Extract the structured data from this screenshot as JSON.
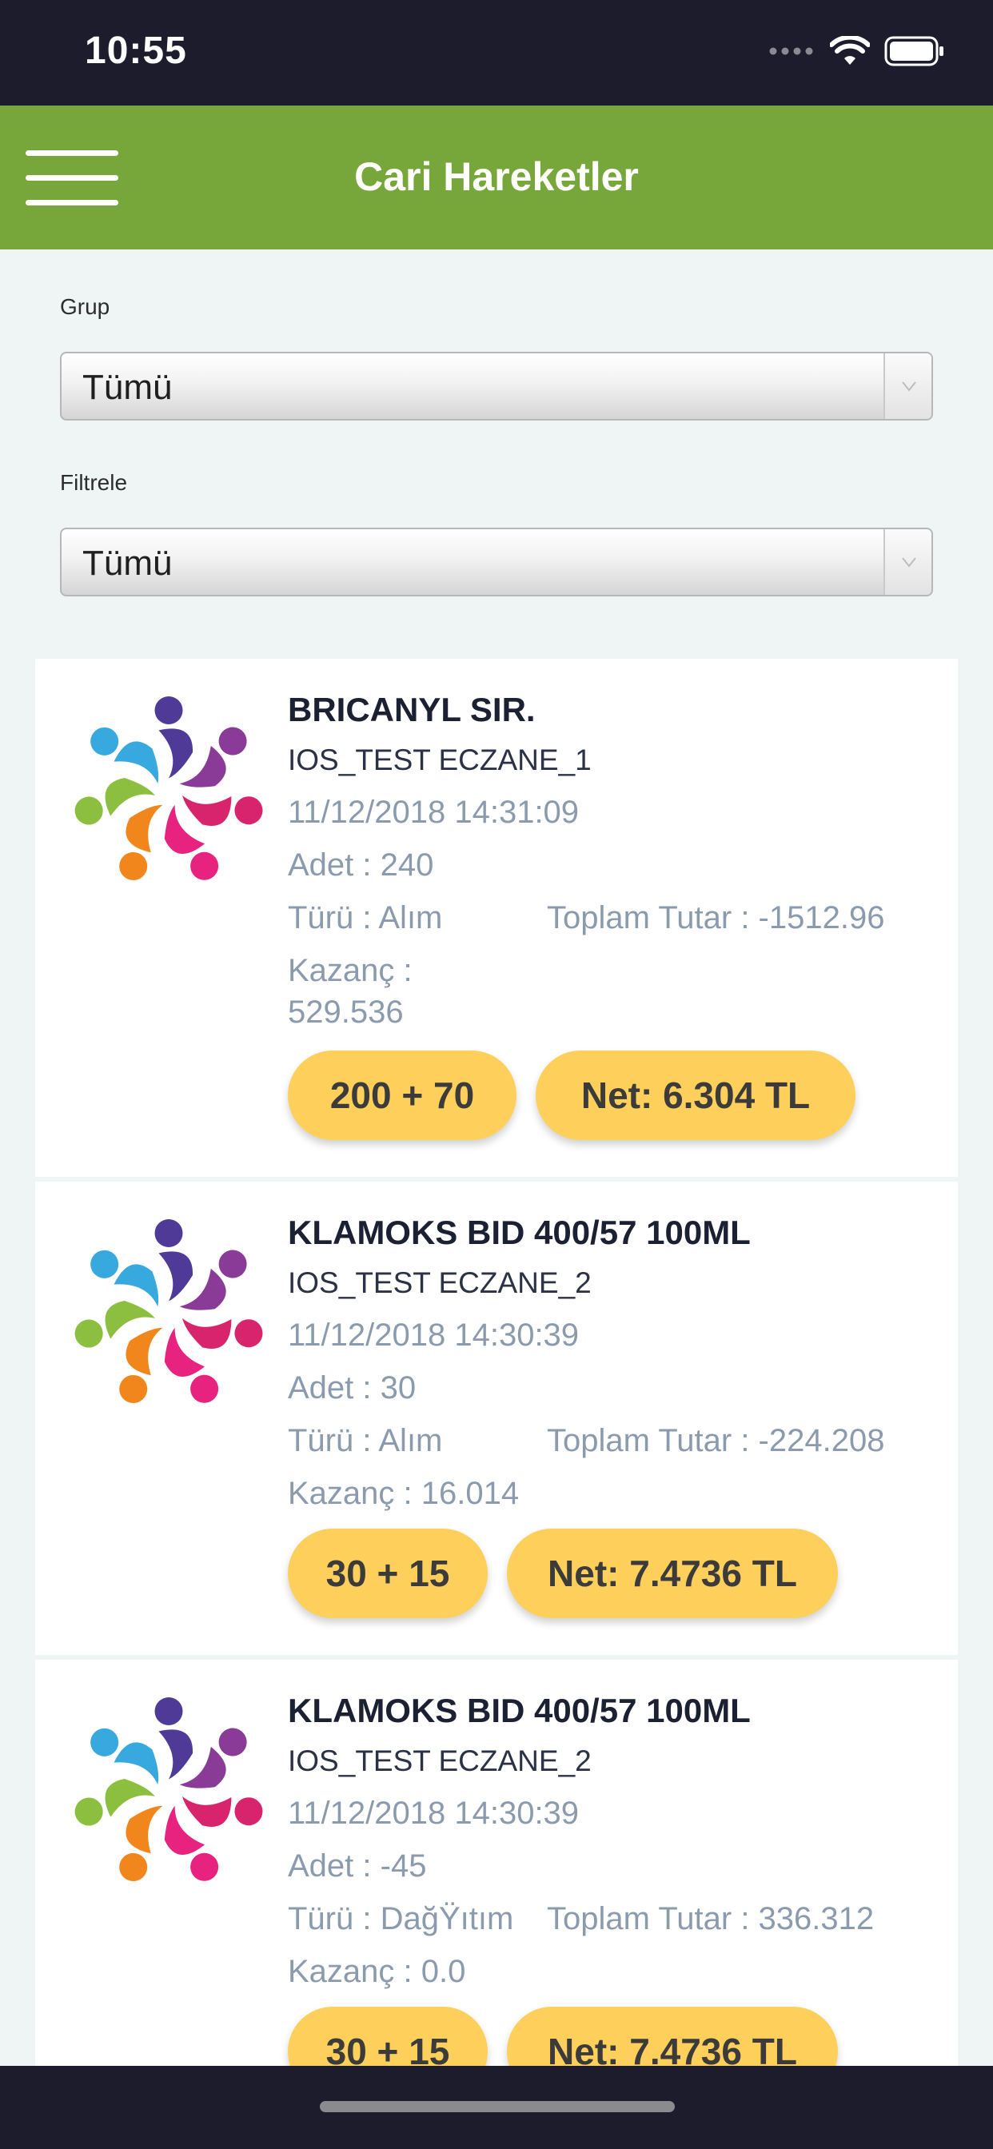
{
  "status_bar": {
    "time": "10:55"
  },
  "header": {
    "title": "Cari Hareketler"
  },
  "filters": {
    "group_label": "Grup",
    "group_value": "Tümü",
    "filter_label": "Filtrele",
    "filter_value": "Tümü"
  },
  "transactions": [
    {
      "title": "BRICANYL SIR.",
      "pharmacy": "IOS_TEST ECZANE_1",
      "datetime": "11/12/2018 14:31:09",
      "quantity": "Adet : 240",
      "type": "Türü : Alım",
      "total": "Toplam Tutar : -1512.96",
      "profit_line1": "Kazanç :",
      "profit_line2": "529.536",
      "campaign": "200 + 70",
      "net": "Net: 6.304 TL"
    },
    {
      "title": "KLAMOKS BID 400/57 100ML",
      "pharmacy": "IOS_TEST ECZANE_2",
      "datetime": "11/12/2018 14:30:39",
      "quantity": "Adet : 30",
      "type": "Türü : Alım",
      "total": "Toplam Tutar : -224.208",
      "profit": "Kazanç : 16.014",
      "campaign": "30 + 15",
      "net": "Net: 7.4736 TL"
    },
    {
      "title": "KLAMOKS BID 400/57 100ML",
      "pharmacy": "IOS_TEST ECZANE_2",
      "datetime": "11/12/2018 14:30:39",
      "quantity": "Adet : -45",
      "type": "Türü : DağŸıtım",
      "total": "Toplam Tutar : 336.312",
      "profit": "Kazanç : 0.0",
      "campaign": "30 + 15",
      "net": "Net: 7.4736 TL"
    }
  ],
  "colors": {
    "header_green": "#77a73a",
    "pill_yellow": "#fecf5a",
    "status_dark": "#1c1c2c",
    "background": "#eef5f4",
    "meta_gray": "#8b9bad"
  },
  "icons": {
    "menu": "hamburger-menu-icon",
    "logo": "people-circle-logo",
    "select_arrow": "chevron-down-icon",
    "signal": "cellular-signal-icon",
    "wifi": "wifi-icon",
    "battery": "battery-icon"
  }
}
